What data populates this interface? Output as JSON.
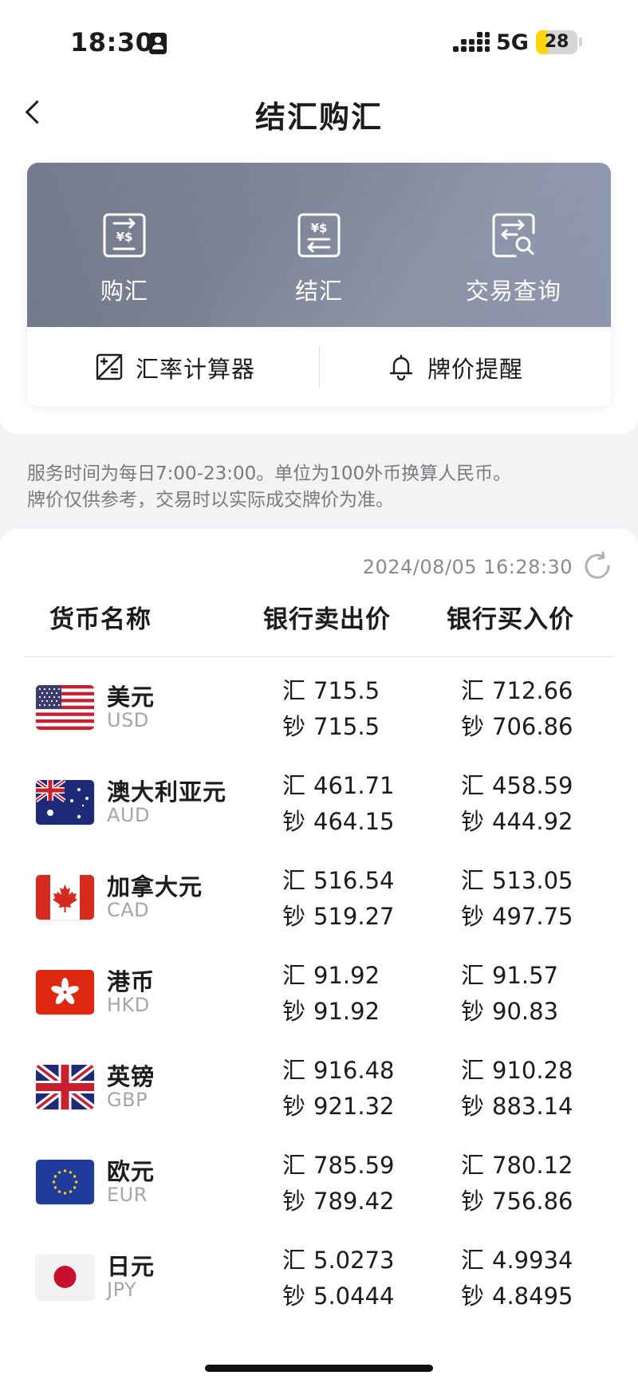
{
  "status_bar": {
    "time": "18:30",
    "network": "5G",
    "battery": "28",
    "battery_fraction": 0.28,
    "battery_color": "#ffd60a",
    "icons": [
      "person-badge-icon",
      "signal-icon",
      "battery-icon"
    ]
  },
  "header": {
    "title": "结汇购汇",
    "back_icon": "chevron-left-icon"
  },
  "actions": [
    {
      "label": "购汇",
      "icon": "purchase-fx-icon"
    },
    {
      "label": "结汇",
      "icon": "settle-fx-icon"
    },
    {
      "label": "交易查询",
      "icon": "transaction-search-icon"
    }
  ],
  "tools": [
    {
      "label": "汇率计算器",
      "icon": "calculator-icon"
    },
    {
      "label": "牌价提醒",
      "icon": "bell-icon"
    }
  ],
  "notice": {
    "line1": "服务时间为每日7:00-23:00。单位为100外币换算人民币。",
    "line2": "牌价仅供参考，交易时以实际成交牌价为准。"
  },
  "rates": {
    "updated_at": "2024/08/05 16:28:30",
    "refresh_icon": "refresh-icon",
    "headers": {
      "name": "货币名称",
      "sell": "银行卖出价",
      "buy": "银行买入价"
    },
    "remit_tag": "汇",
    "cash_tag": "钞",
    "currencies": [
      {
        "name": "美元",
        "code": "USD",
        "flag": "us-flag-icon",
        "sell_remit": "715.5",
        "sell_cash": "715.5",
        "buy_remit": "712.66",
        "buy_cash": "706.86"
      },
      {
        "name": "澳大利亚元",
        "code": "AUD",
        "flag": "au-flag-icon",
        "sell_remit": "461.71",
        "sell_cash": "464.15",
        "buy_remit": "458.59",
        "buy_cash": "444.92"
      },
      {
        "name": "加拿大元",
        "code": "CAD",
        "flag": "ca-flag-icon",
        "sell_remit": "516.54",
        "sell_cash": "519.27",
        "buy_remit": "513.05",
        "buy_cash": "497.75"
      },
      {
        "name": "港币",
        "code": "HKD",
        "flag": "hk-flag-icon",
        "sell_remit": "91.92",
        "sell_cash": "91.92",
        "buy_remit": "91.57",
        "buy_cash": "90.83"
      },
      {
        "name": "英镑",
        "code": "GBP",
        "flag": "gb-flag-icon",
        "sell_remit": "916.48",
        "sell_cash": "921.32",
        "buy_remit": "910.28",
        "buy_cash": "883.14"
      },
      {
        "name": "欧元",
        "code": "EUR",
        "flag": "eu-flag-icon",
        "sell_remit": "785.59",
        "sell_cash": "789.42",
        "buy_remit": "780.12",
        "buy_cash": "756.86"
      },
      {
        "name": "日元",
        "code": "JPY",
        "flag": "jp-flag-icon",
        "sell_remit": "5.0273",
        "sell_cash": "5.0444",
        "buy_remit": "4.9934",
        "buy_cash": "4.8495"
      }
    ]
  }
}
